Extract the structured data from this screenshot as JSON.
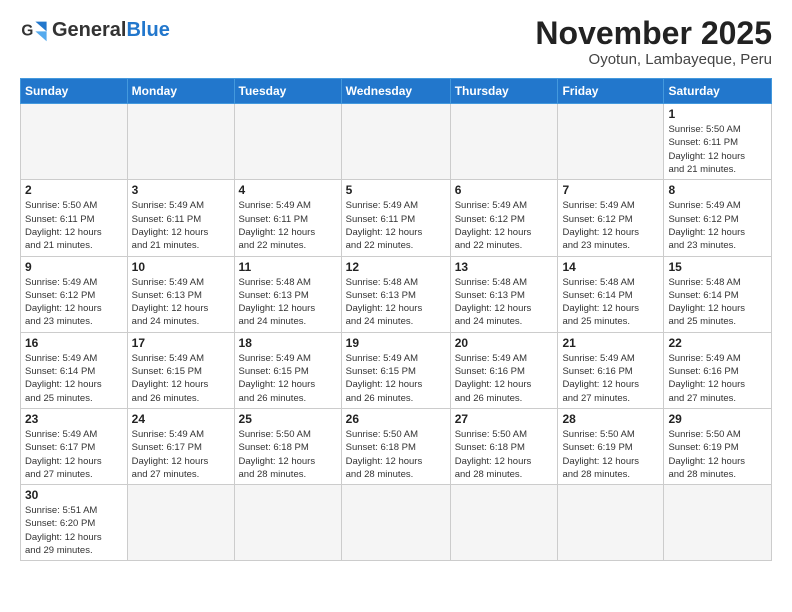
{
  "logo": {
    "general": "General",
    "blue": "Blue"
  },
  "header": {
    "title": "November 2025",
    "subtitle": "Oyotun, Lambayeque, Peru"
  },
  "weekdays": [
    "Sunday",
    "Monday",
    "Tuesday",
    "Wednesday",
    "Thursday",
    "Friday",
    "Saturday"
  ],
  "weeks": [
    [
      {
        "day": "",
        "info": ""
      },
      {
        "day": "",
        "info": ""
      },
      {
        "day": "",
        "info": ""
      },
      {
        "day": "",
        "info": ""
      },
      {
        "day": "",
        "info": ""
      },
      {
        "day": "",
        "info": ""
      },
      {
        "day": "1",
        "info": "Sunrise: 5:50 AM\nSunset: 6:11 PM\nDaylight: 12 hours\nand 21 minutes."
      }
    ],
    [
      {
        "day": "2",
        "info": "Sunrise: 5:50 AM\nSunset: 6:11 PM\nDaylight: 12 hours\nand 21 minutes."
      },
      {
        "day": "3",
        "info": "Sunrise: 5:49 AM\nSunset: 6:11 PM\nDaylight: 12 hours\nand 21 minutes."
      },
      {
        "day": "4",
        "info": "Sunrise: 5:49 AM\nSunset: 6:11 PM\nDaylight: 12 hours\nand 22 minutes."
      },
      {
        "day": "5",
        "info": "Sunrise: 5:49 AM\nSunset: 6:11 PM\nDaylight: 12 hours\nand 22 minutes."
      },
      {
        "day": "6",
        "info": "Sunrise: 5:49 AM\nSunset: 6:12 PM\nDaylight: 12 hours\nand 22 minutes."
      },
      {
        "day": "7",
        "info": "Sunrise: 5:49 AM\nSunset: 6:12 PM\nDaylight: 12 hours\nand 23 minutes."
      },
      {
        "day": "8",
        "info": "Sunrise: 5:49 AM\nSunset: 6:12 PM\nDaylight: 12 hours\nand 23 minutes."
      }
    ],
    [
      {
        "day": "9",
        "info": "Sunrise: 5:49 AM\nSunset: 6:12 PM\nDaylight: 12 hours\nand 23 minutes."
      },
      {
        "day": "10",
        "info": "Sunrise: 5:49 AM\nSunset: 6:13 PM\nDaylight: 12 hours\nand 24 minutes."
      },
      {
        "day": "11",
        "info": "Sunrise: 5:48 AM\nSunset: 6:13 PM\nDaylight: 12 hours\nand 24 minutes."
      },
      {
        "day": "12",
        "info": "Sunrise: 5:48 AM\nSunset: 6:13 PM\nDaylight: 12 hours\nand 24 minutes."
      },
      {
        "day": "13",
        "info": "Sunrise: 5:48 AM\nSunset: 6:13 PM\nDaylight: 12 hours\nand 24 minutes."
      },
      {
        "day": "14",
        "info": "Sunrise: 5:48 AM\nSunset: 6:14 PM\nDaylight: 12 hours\nand 25 minutes."
      },
      {
        "day": "15",
        "info": "Sunrise: 5:48 AM\nSunset: 6:14 PM\nDaylight: 12 hours\nand 25 minutes."
      }
    ],
    [
      {
        "day": "16",
        "info": "Sunrise: 5:49 AM\nSunset: 6:14 PM\nDaylight: 12 hours\nand 25 minutes."
      },
      {
        "day": "17",
        "info": "Sunrise: 5:49 AM\nSunset: 6:15 PM\nDaylight: 12 hours\nand 26 minutes."
      },
      {
        "day": "18",
        "info": "Sunrise: 5:49 AM\nSunset: 6:15 PM\nDaylight: 12 hours\nand 26 minutes."
      },
      {
        "day": "19",
        "info": "Sunrise: 5:49 AM\nSunset: 6:15 PM\nDaylight: 12 hours\nand 26 minutes."
      },
      {
        "day": "20",
        "info": "Sunrise: 5:49 AM\nSunset: 6:16 PM\nDaylight: 12 hours\nand 26 minutes."
      },
      {
        "day": "21",
        "info": "Sunrise: 5:49 AM\nSunset: 6:16 PM\nDaylight: 12 hours\nand 27 minutes."
      },
      {
        "day": "22",
        "info": "Sunrise: 5:49 AM\nSunset: 6:16 PM\nDaylight: 12 hours\nand 27 minutes."
      }
    ],
    [
      {
        "day": "23",
        "info": "Sunrise: 5:49 AM\nSunset: 6:17 PM\nDaylight: 12 hours\nand 27 minutes."
      },
      {
        "day": "24",
        "info": "Sunrise: 5:49 AM\nSunset: 6:17 PM\nDaylight: 12 hours\nand 27 minutes."
      },
      {
        "day": "25",
        "info": "Sunrise: 5:50 AM\nSunset: 6:18 PM\nDaylight: 12 hours\nand 28 minutes."
      },
      {
        "day": "26",
        "info": "Sunrise: 5:50 AM\nSunset: 6:18 PM\nDaylight: 12 hours\nand 28 minutes."
      },
      {
        "day": "27",
        "info": "Sunrise: 5:50 AM\nSunset: 6:18 PM\nDaylight: 12 hours\nand 28 minutes."
      },
      {
        "day": "28",
        "info": "Sunrise: 5:50 AM\nSunset: 6:19 PM\nDaylight: 12 hours\nand 28 minutes."
      },
      {
        "day": "29",
        "info": "Sunrise: 5:50 AM\nSunset: 6:19 PM\nDaylight: 12 hours\nand 28 minutes."
      }
    ],
    [
      {
        "day": "30",
        "info": "Sunrise: 5:51 AM\nSunset: 6:20 PM\nDaylight: 12 hours\nand 29 minutes."
      },
      {
        "day": "",
        "info": ""
      },
      {
        "day": "",
        "info": ""
      },
      {
        "day": "",
        "info": ""
      },
      {
        "day": "",
        "info": ""
      },
      {
        "day": "",
        "info": ""
      },
      {
        "day": "",
        "info": ""
      }
    ]
  ]
}
